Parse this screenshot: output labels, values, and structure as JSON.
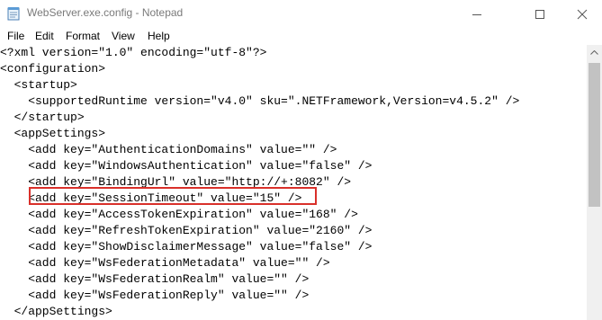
{
  "window": {
    "title": "WebServer.exe.config - Notepad",
    "icon": "notepad-icon",
    "controls": [
      "minimize-icon",
      "maximize-icon",
      "close-icon"
    ]
  },
  "menu": {
    "items": [
      {
        "label": "File"
      },
      {
        "label": "Edit"
      },
      {
        "label": "Format"
      },
      {
        "label": "View"
      },
      {
        "label": "Help"
      }
    ]
  },
  "editor": {
    "lines": [
      "<?xml version=\"1.0\" encoding=\"utf-8\"?>",
      "<configuration>",
      "  <startup>",
      "    <supportedRuntime version=\"v4.0\" sku=\".NETFramework,Version=v4.5.2\" />",
      "  </startup>",
      "  <appSettings>",
      "    <add key=\"AuthenticationDomains\" value=\"\" />",
      "    <add key=\"WindowsAuthentication\" value=\"false\" />",
      "    <add key=\"BindingUrl\" value=\"http://+:8082\" />",
      "    <add key=\"SessionTimeout\" value=\"15\" />",
      "    <add key=\"AccessTokenExpiration\" value=\"168\" />",
      "    <add key=\"RefreshTokenExpiration\" value=\"2160\" />",
      "    <add key=\"ShowDisclaimerMessage\" value=\"false\" />",
      "    <add key=\"WsFederationMetadata\" value=\"\" />",
      "    <add key=\"WsFederationRealm\" value=\"\" />",
      "    <add key=\"WsFederationReply\" value=\"\" />",
      "  </appSettings>"
    ],
    "highlight_color": "#d9302a"
  },
  "colors": {
    "title_text": "#7a7a7a",
    "text": "#000000",
    "scrollbar_track": "#f0f0f0",
    "scrollbar_thumb": "#c2c2c2"
  }
}
